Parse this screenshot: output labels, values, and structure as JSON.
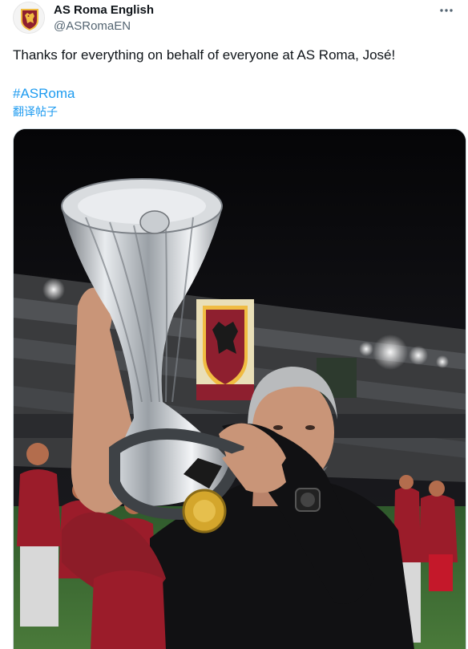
{
  "tweet": {
    "author": {
      "display_name": "AS Roma English",
      "handle": "@ASRomaEN",
      "avatar_icon": "as-roma-crest-icon"
    },
    "more_icon": "more-options-icon",
    "text": "Thanks for everything on behalf of everyone at AS Roma, José!",
    "hashtag": "#ASRoma",
    "translate_label": "翻译帖子",
    "media": {
      "kind": "photo"
    }
  },
  "colors": {
    "text_primary": "#0f1419",
    "text_secondary": "#536471",
    "link": "#1d9bf0",
    "roma_red": "#8e1f2f",
    "roma_gold": "#f0bc42"
  }
}
